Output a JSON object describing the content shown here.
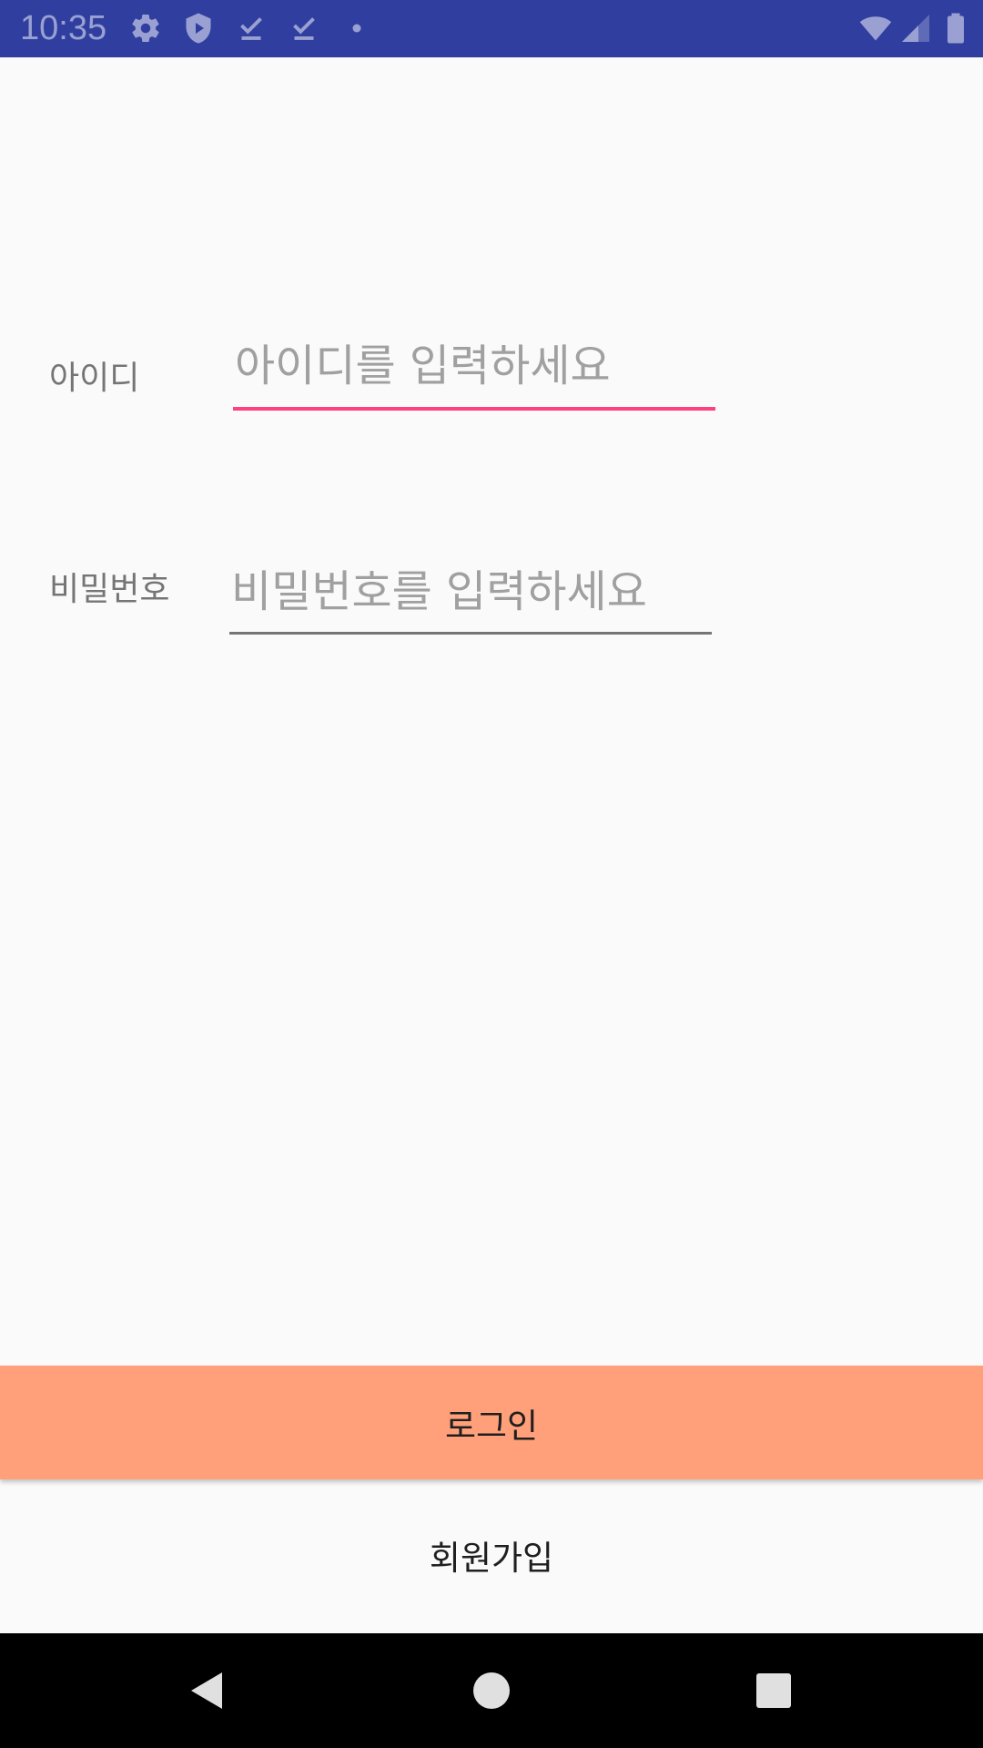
{
  "status_bar": {
    "time": "10:35",
    "left_icons": [
      "gear-icon",
      "shield-icon",
      "download-done-icon",
      "download-done-icon",
      "dot-icon"
    ],
    "right_icons": [
      "wifi-icon",
      "cell-signal-icon",
      "battery-icon"
    ],
    "background": "#303f9f"
  },
  "form": {
    "id": {
      "label": "아이디",
      "placeholder": "아이디를 입력하세요",
      "value": "",
      "underline_color": "#ff4081",
      "focused": true
    },
    "password": {
      "label": "비밀번호",
      "placeholder": "비밀번호를 입력하세요",
      "value": "",
      "underline_color": "#757575",
      "focused": false
    }
  },
  "buttons": {
    "login_label": "로그인",
    "login_color": "#ffa07a",
    "signup_label": "회원가입"
  },
  "nav_bar": {
    "icons": [
      "back-icon",
      "home-icon",
      "recents-icon"
    ]
  }
}
